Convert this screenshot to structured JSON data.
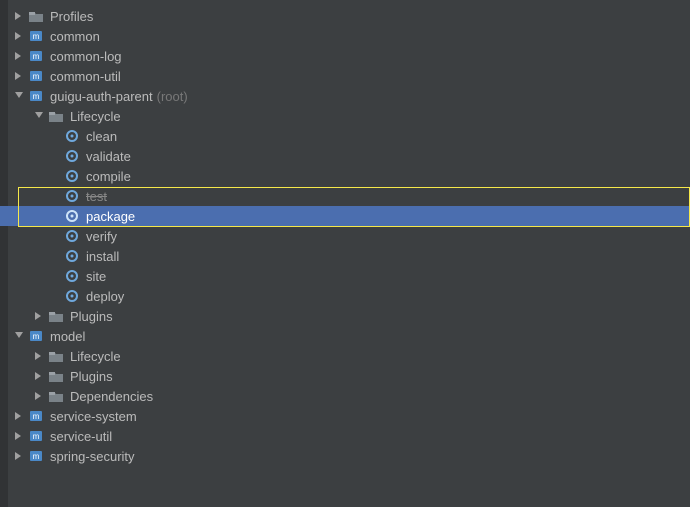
{
  "tree": {
    "profiles": "Profiles",
    "common": "common",
    "common_log": "common-log",
    "common_util": "common-util",
    "guigu_auth_parent": "guigu-auth-parent",
    "guigu_suffix": "(root)",
    "lifecycle": "Lifecycle",
    "clean": "clean",
    "validate": "validate",
    "compile": "compile",
    "test": "test",
    "package": "package",
    "verify": "verify",
    "install": "install",
    "site": "site",
    "deploy": "deploy",
    "plugins1": "Plugins",
    "model": "model",
    "lifecycle2": "Lifecycle",
    "plugins2": "Plugins",
    "dependencies": "Dependencies",
    "service_system": "service-system",
    "service_util": "service-util",
    "spring_security": "spring-security"
  }
}
